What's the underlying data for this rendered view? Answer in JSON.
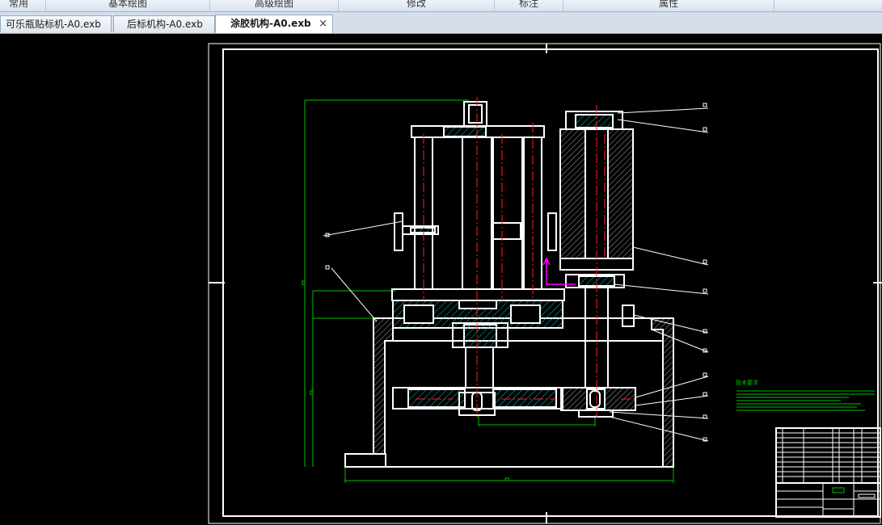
{
  "ribbon": {
    "groups": [
      "常用",
      "基本绘图",
      "高级绘图",
      "修改",
      "标注",
      "属性"
    ]
  },
  "tabs": [
    {
      "label": "可乐瓶贴标机-A0.exb",
      "active": false
    },
    {
      "label": "后标机构-A0.exb",
      "active": false
    },
    {
      "label": "涂胶机构-A0.exb",
      "active": true,
      "close": "×"
    }
  ],
  "drawing": {
    "notes_title": "技术要求"
  },
  "colors": {
    "background": "#000000",
    "lines": "#ffffff",
    "dimensions": "#00c000",
    "centerlines": "#ff2020",
    "hatch": "#00c8c8",
    "highlight": "#ff00ff",
    "tab_active": "#ffffff"
  }
}
